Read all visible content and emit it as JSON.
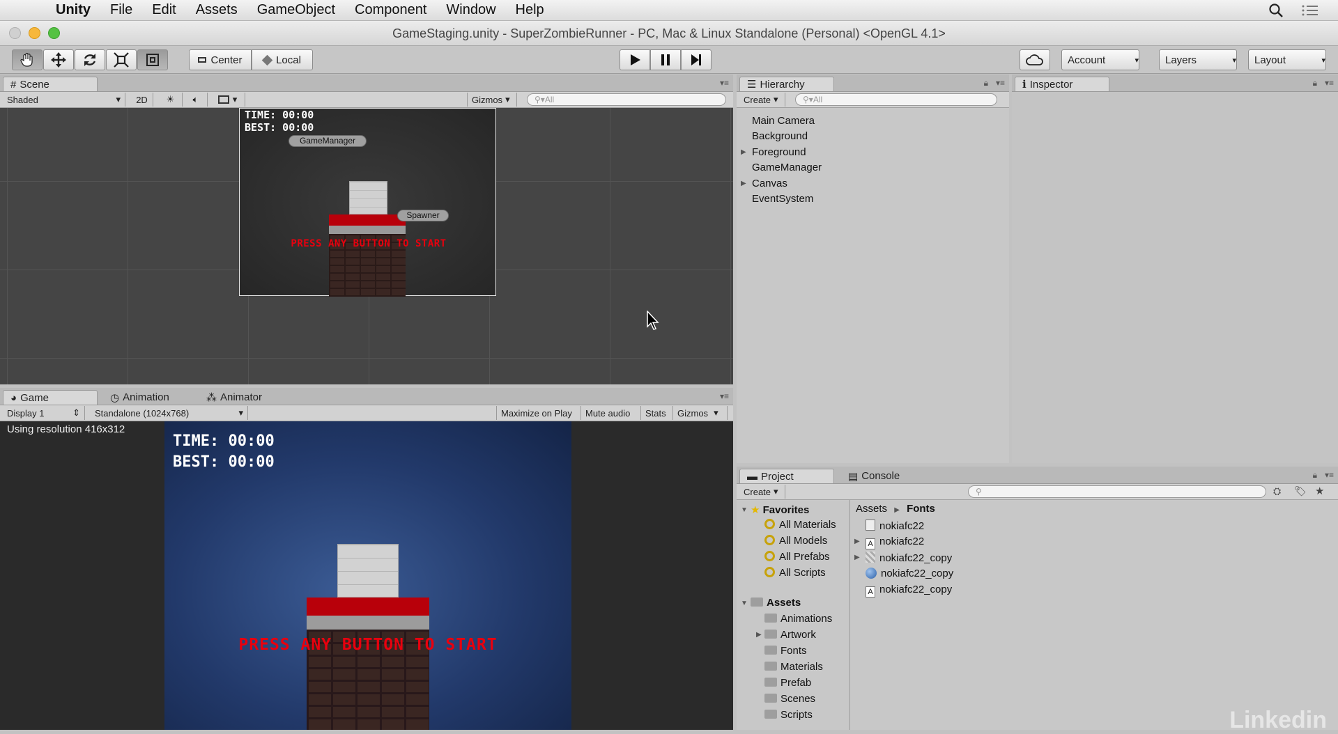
{
  "menubar": {
    "app": "Unity",
    "items": [
      "File",
      "Edit",
      "Assets",
      "GameObject",
      "Component",
      "Window",
      "Help"
    ]
  },
  "window": {
    "title": "GameStaging.unity - SuperZombieRunner - PC, Mac & Linux Standalone (Personal) <OpenGL 4.1>"
  },
  "toolbar": {
    "center": "Center",
    "local": "Local",
    "account": "Account",
    "layers": "Layers",
    "layout": "Layout"
  },
  "scene": {
    "tab": "Scene",
    "shading": "Shaded",
    "mode2d": "2D",
    "gizmos": "Gizmos",
    "search_placeholder": "All",
    "time": "TIME: 00:00",
    "best": "BEST: 00:00",
    "game_manager": "GameManager",
    "spawner": "Spawner",
    "press": "PRESS ANY BUTTON TO START"
  },
  "game": {
    "tabs": [
      "Game",
      "Animation",
      "Animator"
    ],
    "display": "Display 1",
    "resolution": "Standalone (1024x768)",
    "maximize": "Maximize on Play",
    "mute": "Mute audio",
    "stats": "Stats",
    "gizmos": "Gizmos",
    "res_note": "Using resolution 416x312",
    "time": "TIME: 00:00",
    "best": "BEST: 00:00",
    "press": "PRESS ANY BUTTON TO START"
  },
  "hierarchy": {
    "tab": "Hierarchy",
    "create": "Create",
    "search_placeholder": "All",
    "items": [
      "Main Camera",
      "Background",
      "Foreground",
      "GameManager",
      "Canvas",
      "EventSystem"
    ]
  },
  "inspector": {
    "tab": "Inspector"
  },
  "project": {
    "tabs": [
      "Project",
      "Console"
    ],
    "create": "Create",
    "favorites_label": "Favorites",
    "favorites": [
      "All Materials",
      "All Models",
      "All Prefabs",
      "All Scripts"
    ],
    "assets_label": "Assets",
    "folders": [
      "Animations",
      "Artwork",
      "Fonts",
      "Materials",
      "Prefab",
      "Scenes",
      "Scripts"
    ],
    "breadcrumb": [
      "Assets",
      "Fonts"
    ],
    "files": [
      "nokiafc22",
      "nokiafc22",
      "nokiafc22_copy",
      "nokiafc22_copy",
      "nokiafc22_copy"
    ]
  },
  "watermark": "Linkedin"
}
